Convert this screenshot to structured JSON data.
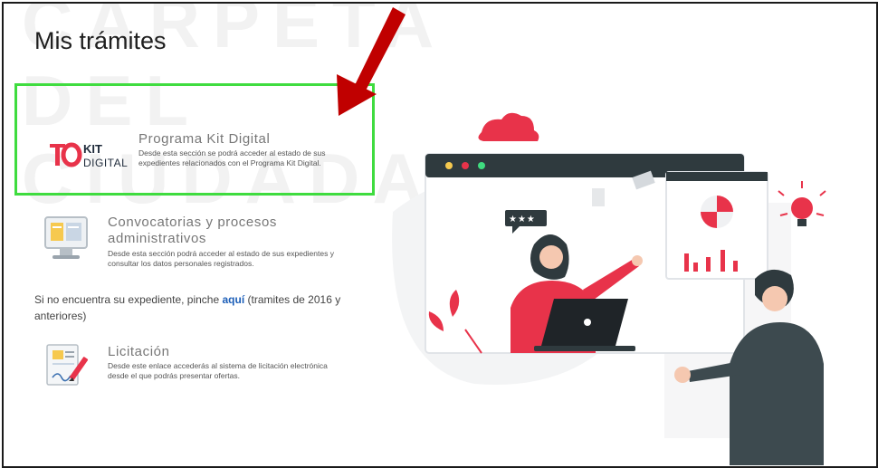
{
  "watermark": {
    "text": "CARPETA DEL\nCIUDADANO"
  },
  "page": {
    "title": "Mis trámites"
  },
  "kit_digital": {
    "logo_top": "KIT",
    "logo_bottom": "DIGITAL",
    "title": "Programa Kit Digital",
    "description": "Desde esta sección se podrá acceder al estado de sus expedientes relacionados con el Programa Kit Digital."
  },
  "convocatorias": {
    "title": "Convocatorias y procesos administrativos",
    "description": "Desde esta sección podrá acceder al estado de sus expedientes y consultar los datos personales registrados."
  },
  "not_found": {
    "prefix": "Si no encuentra su expediente, pinche ",
    "link": "aquí",
    "suffix": " (tramites de 2016 y anteriores)"
  },
  "licitacion": {
    "title": "Licitación",
    "description": "Desde este enlace accederás al sistema de licitación electrónica desde el que podrás presentar ofertas."
  },
  "illustration": {
    "rating_stars": "★★★"
  },
  "colors": {
    "highlight": "#3fdc3f",
    "arrow": "#c00000",
    "accent": "#e8334a",
    "link": "#1d5fb8",
    "dark": "#2f3a3e"
  },
  "icons": [
    "arrow-annotation",
    "kit-digital-logo",
    "monitor-icon",
    "document-pen-icon",
    "cloud-icon",
    "lightbulb-icon",
    "laptop-icon"
  ]
}
